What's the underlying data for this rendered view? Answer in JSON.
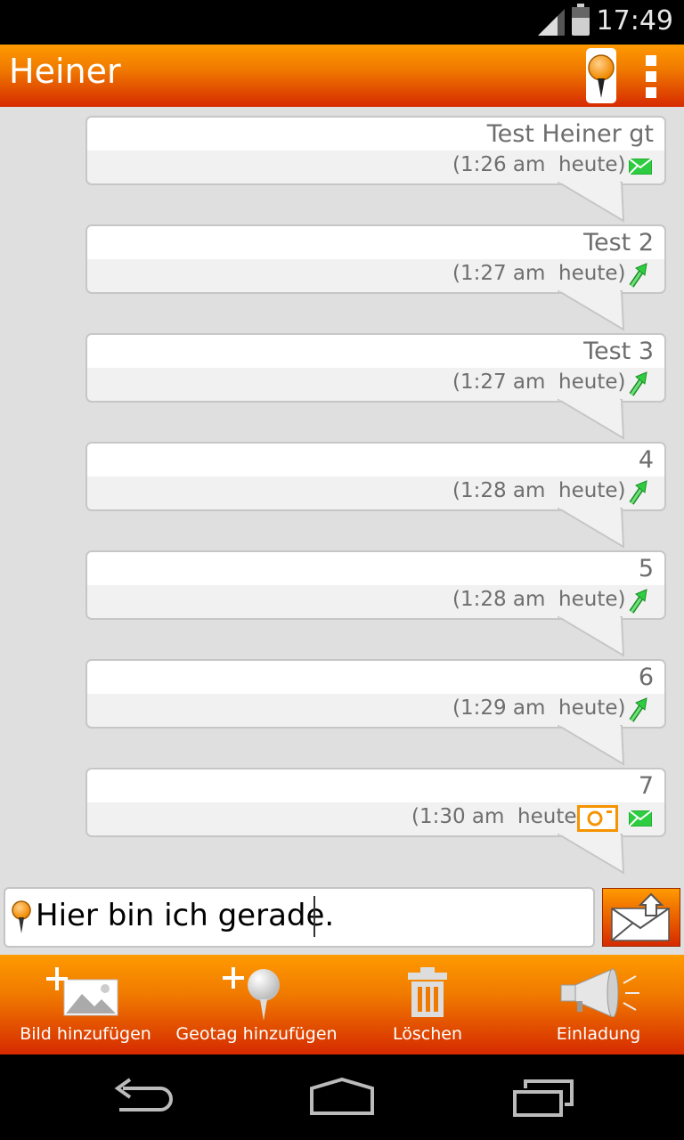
{
  "status_bar": {
    "time": "17:49"
  },
  "action_bar": {
    "title": "Heiner",
    "map_pin_icon": "map-pin-icon",
    "overflow_icon": "overflow-menu-icon"
  },
  "messages": [
    {
      "text": "Test Heiner gt",
      "time": "(1:26 am  heute)",
      "status": "sent-mail"
    },
    {
      "text": "Test 2",
      "time": "(1:27 am  heute)",
      "status": "sent-arrow"
    },
    {
      "text": "Test 3",
      "time": "(1:27 am  heute)",
      "status": "sent-arrow"
    },
    {
      "text": "4",
      "time": "(1:28 am  heute)",
      "status": "sent-arrow"
    },
    {
      "text": "5",
      "time": "(1:28 am  heute)",
      "status": "sent-arrow"
    },
    {
      "text": "6",
      "time": "(1:29 am  heute)",
      "status": "sent-arrow"
    },
    {
      "text": "7",
      "time": "(1:30 am  heute)",
      "status": "sent-mail-with-photo"
    }
  ],
  "composer": {
    "value": "Hier bin ich gerade."
  },
  "toolbar": {
    "add_image": "Bild hinzufügen",
    "add_geotag": "Geotag hinzufügen",
    "delete": "Löschen",
    "invite": "Einladung"
  },
  "colors": {
    "accent_top": "#ff9a00",
    "accent_bottom": "#d62a00",
    "status_green": "#2ecc40",
    "photo_orange": "#f59300"
  }
}
